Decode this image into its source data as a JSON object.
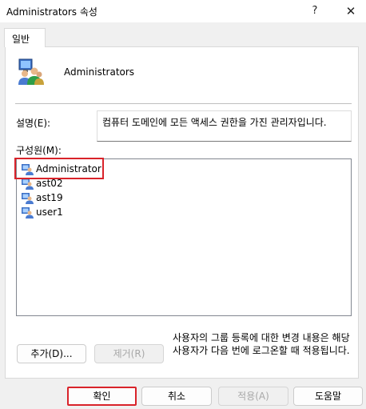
{
  "window": {
    "title": "Administrators 속성",
    "help_glyph": "?",
    "close_glyph": "✕"
  },
  "tabs": [
    {
      "label": "일반"
    }
  ],
  "group": {
    "name": "Administrators",
    "icon": "group-users-icon"
  },
  "description": {
    "label": "설명(E):",
    "value": "컴퓨터 도메인에 모든 액세스 권한을 가진 관리자입니다."
  },
  "members": {
    "label": "구성원(M):",
    "items": [
      {
        "name": "Administrator",
        "icon": "user-icon"
      },
      {
        "name": "ast02",
        "icon": "user-icon"
      },
      {
        "name": "ast19",
        "icon": "user-icon"
      },
      {
        "name": "user1",
        "icon": "user-icon"
      }
    ]
  },
  "info_text": "사용자의 그룹 등록에 대한 변경 내용은 해당 사용자가 다음 번에 로그온할 때 적용됩니다.",
  "buttons": {
    "add": "추가(D)...",
    "remove": "제거(R)",
    "ok": "확인",
    "cancel": "취소",
    "apply": "적용(A)",
    "help": "도움말"
  },
  "colors": {
    "highlight": "#d9232a",
    "dialog_bg": "#f0f0f0",
    "panel_bg": "#ffffff"
  }
}
